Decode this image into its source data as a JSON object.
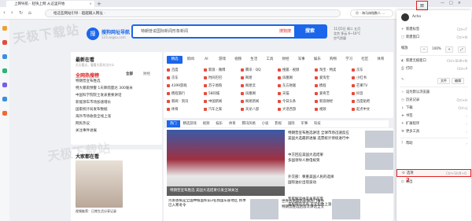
{
  "tab": {
    "title": "上网导航 - 轻快上网 从这里开始",
    "close": "×",
    "new_tab": "+"
  },
  "window": {
    "min": "—",
    "max": "□",
    "close": "×"
  },
  "toolbar": {
    "url": "hao.360.com",
    "url_hint": "给这些网站引导 · 超越输入网址 ·",
    "side_search": "😊 · 海马体指数人 ...",
    "menu_icon": "≡"
  },
  "annotations": {
    "one": "1",
    "two": "2"
  },
  "watermark": {
    "line1": "天极下载站",
    "line2": "天极下载站"
  },
  "logo": {
    "mark": "搜",
    "name": "搜狗网址导航",
    "sub": "123.sogou.com"
  },
  "search": {
    "placeholder": "特朗普说国际新闻形象新闻",
    "engine": "搜狗搜",
    "button": "搜索"
  },
  "weather": {
    "line1": "11月5日 周二 五月",
    "line2": "北京 多云 6~16°C",
    "line3": "空气质量"
  },
  "left": {
    "title": "最新在看",
    "sub": "天天看点，看看大家关注什么",
    "hot_title": "全网热搜榜",
    "hot_tab": "全部",
    "hot_tab2": "财经",
    "hot": [
      "特朗普宣布胜选",
      "特大暴雨预警 1天降雨量达 300毫米",
      "中国科学院院士发表重要讲话",
      "新能源车市场加速增长",
      "国家统计局发布数据",
      "海外市场收盘全线上涨",
      "网民热议",
      "关注事件进展"
    ],
    "video_title": "大家都在看",
    "video_caption": "视频推荐：日常生活分享记录"
  },
  "categories": [
    "精选",
    "新闻",
    "AI",
    "游戏",
    "视频",
    "生活",
    "工具",
    "财经",
    "军事",
    "娱乐",
    "购物",
    "学习",
    "社区",
    "体育"
  ],
  "sites": [
    "百度",
    "新浪 · 微博",
    "腾讯 · QQ",
    "搜狐 · 视频",
    "淘宝 · 特卖",
    "京东",
    "京东",
    "时间巴巴",
    "网易",
    "凤凰网",
    "爱淘宝",
    "小红书",
    "4399游戏",
    "苏宁易购",
    "网易云",
    "东方财富",
    "携程",
    "芒果TV",
    "携程旅行",
    "58同城",
    "凤凰网",
    "天猫",
    "爱奇艺",
    "抖音",
    "新闻 · 资讯",
    "中国新闻",
    "网易新闻",
    "今日头条",
    "新浪财经",
    "百度贴吧",
    "体育",
    "汽车之家",
    "天龙八部",
    "大话西游",
    "视频",
    "起点中文"
  ],
  "news_tabs": [
    "热门",
    "精选游戏",
    "视频",
    "娱乐",
    "体育",
    "腾讯风格",
    "小说",
    "影视",
    "国际",
    "军事",
    "科技",
    "历史"
  ],
  "headline": "特朗普宣布胜选 美国大选结果引发全球关注",
  "news_right": [
    "特朗普宣布胜选讲话 全球市场迅速反应",
    "美国大选最新进展 选票统计持续进行中",
    "中方回应美国大选结果",
    "多国领导人致电祝贺",
    "外交部：尊重美国人民的选择",
    "国际油价出现波动",
    "专家解读中美关系前景",
    "美股期货走高 美元指数上涨"
  ],
  "news_bottom": [
    "河南香蕉是全国种植面积前3名我国东部地区 秋季已入寒冬令",
    "世界各地最新新闻热门事件",
    "特朗普胜选后首次讲话全文"
  ],
  "menu": {
    "user": "Acho",
    "items": [
      {
        "label": "新建标签",
        "shortcut": "Ctrl+T",
        "icon": "plus-icon"
      },
      {
        "label": "新建窗口",
        "shortcut": "Ctrl+N",
        "icon": "window-icon"
      },
      {
        "label": "新建无痕窗口",
        "shortcut": "Ctrl+Shift+N",
        "icon": "incognito-icon"
      },
      {
        "label": "打印",
        "shortcut": "Ctrl+P",
        "icon": "printer-icon"
      },
      {
        "label": "设为默认浏览器",
        "shortcut": "",
        "icon": "star-icon"
      },
      {
        "label": "历史记录",
        "shortcut": "Ctrl+H",
        "icon": "history-icon"
      },
      {
        "label": "下载",
        "shortcut": "Ctrl+J",
        "icon": "download-icon"
      },
      {
        "label": "书签",
        "shortcut": "",
        "icon": "bookmark-icon"
      },
      {
        "label": "扩展程序",
        "shortcut": "",
        "icon": "puzzle-icon"
      },
      {
        "label": "更多工具",
        "shortcut": "",
        "icon": "tools-icon"
      },
      {
        "label": "帮助",
        "shortcut": "",
        "icon": "help-icon"
      },
      {
        "label": "选项",
        "shortcut": "Ctrl+Shift+O",
        "icon": "gear-icon"
      },
      {
        "label": "退出",
        "shortcut": "",
        "icon": "exit-icon"
      }
    ],
    "zoom_label": "缩放",
    "zoom_minus": "−",
    "zoom_value": "100%",
    "zoom_plus": "+",
    "file_label": "文件",
    "edit_label": "编辑"
  },
  "colors": {
    "accent": "#1b66ea",
    "highlight": "#e02020"
  }
}
